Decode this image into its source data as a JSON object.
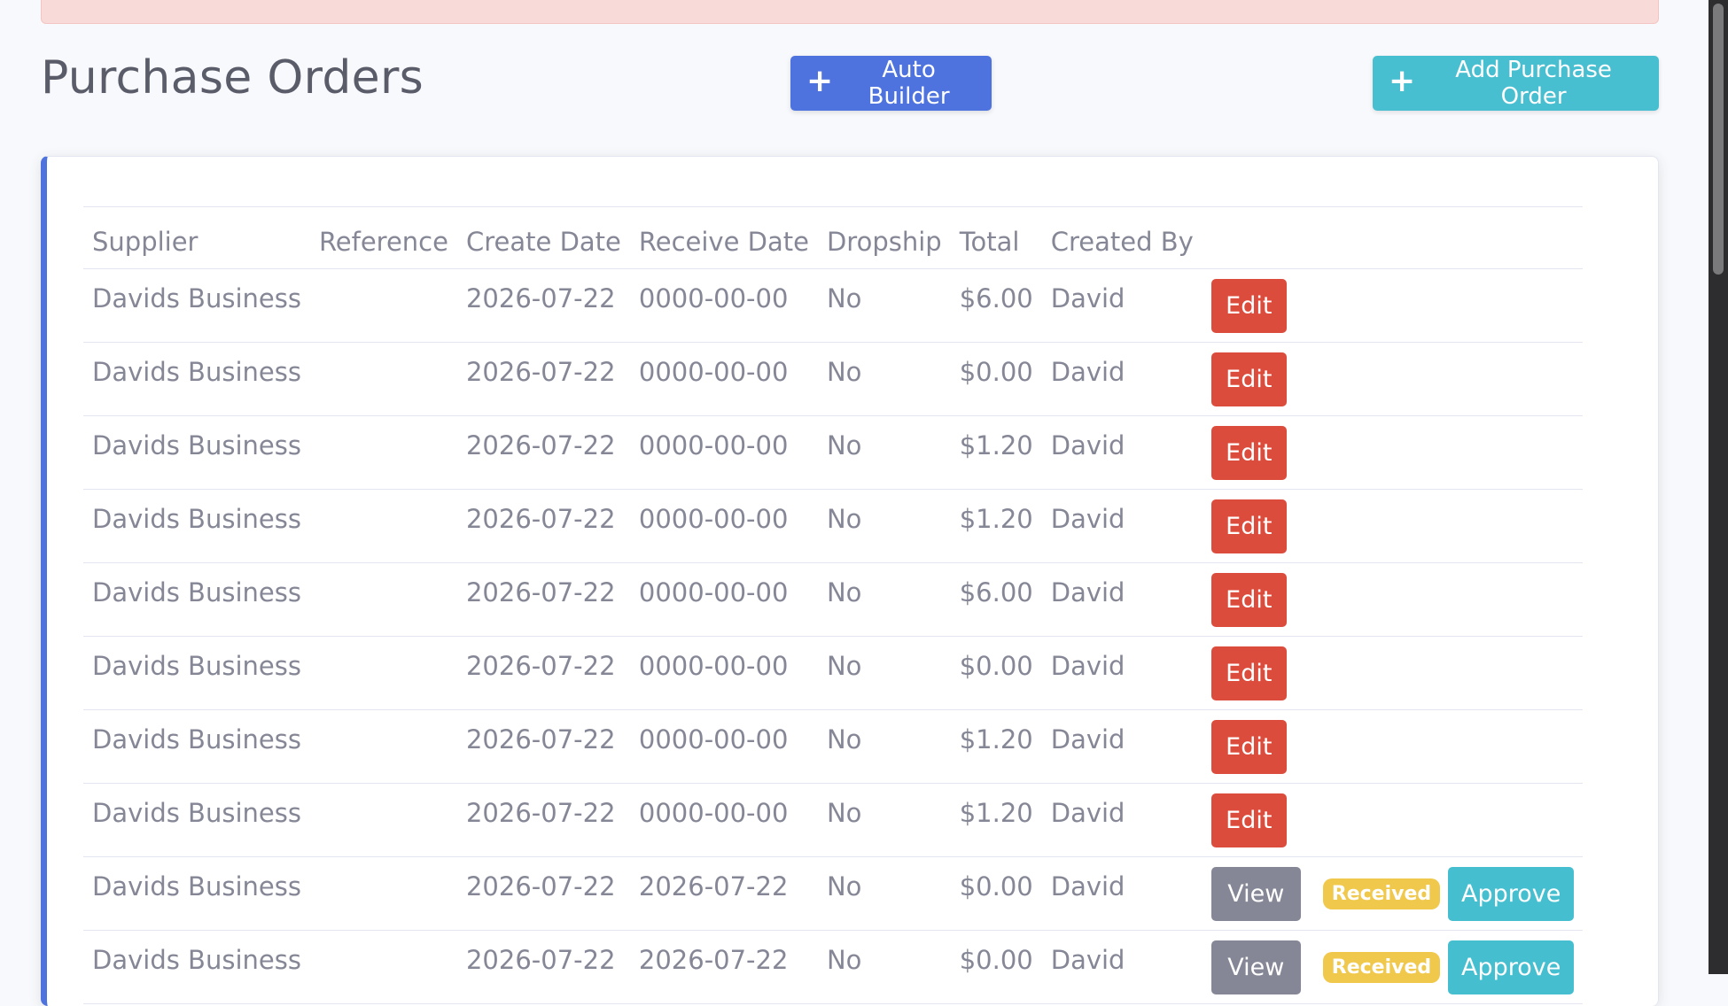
{
  "page": {
    "title": "Purchase Orders",
    "auto_builder_label": "Auto Builder",
    "add_po_label": "Add Purchase Order"
  },
  "colors": {
    "primary": "#4e73df",
    "info": "#36b9cc",
    "danger": "#dc4c3c",
    "secondary": "#858796",
    "warning": "#f0c84b",
    "alert_bg": "#f8dad8"
  },
  "icons": {
    "plus": "plus-icon"
  },
  "table": {
    "columns": [
      "Supplier",
      "Reference",
      "Create Date",
      "Receive Date",
      "Dropship",
      "Total",
      "Created By"
    ],
    "rows": [
      {
        "supplier": "Davids Business",
        "reference": "",
        "create_date": "2026-07-22",
        "receive_date": "0000-00-00",
        "dropship": "No",
        "total": "$6.00",
        "created_by": "David",
        "edit_label": "Edit"
      },
      {
        "supplier": "Davids Business",
        "reference": "",
        "create_date": "2026-07-22",
        "receive_date": "0000-00-00",
        "dropship": "No",
        "total": "$0.00",
        "created_by": "David",
        "edit_label": "Edit"
      },
      {
        "supplier": "Davids Business",
        "reference": "",
        "create_date": "2026-07-22",
        "receive_date": "0000-00-00",
        "dropship": "No",
        "total": "$1.20",
        "created_by": "David",
        "edit_label": "Edit"
      },
      {
        "supplier": "Davids Business",
        "reference": "",
        "create_date": "2026-07-22",
        "receive_date": "0000-00-00",
        "dropship": "No",
        "total": "$1.20",
        "created_by": "David",
        "edit_label": "Edit"
      },
      {
        "supplier": "Davids Business",
        "reference": "",
        "create_date": "2026-07-22",
        "receive_date": "0000-00-00",
        "dropship": "No",
        "total": "$6.00",
        "created_by": "David",
        "edit_label": "Edit"
      },
      {
        "supplier": "Davids Business",
        "reference": "",
        "create_date": "2026-07-22",
        "receive_date": "0000-00-00",
        "dropship": "No",
        "total": "$0.00",
        "created_by": "David",
        "edit_label": "Edit"
      },
      {
        "supplier": "Davids Business",
        "reference": "",
        "create_date": "2026-07-22",
        "receive_date": "0000-00-00",
        "dropship": "No",
        "total": "$1.20",
        "created_by": "David",
        "edit_label": "Edit"
      },
      {
        "supplier": "Davids Business",
        "reference": "",
        "create_date": "2026-07-22",
        "receive_date": "0000-00-00",
        "dropship": "No",
        "total": "$1.20",
        "created_by": "David",
        "edit_label": "Edit"
      },
      {
        "supplier": "Davids Business",
        "reference": "",
        "create_date": "2026-07-22",
        "receive_date": "2026-07-22",
        "dropship": "No",
        "total": "$0.00",
        "created_by": "David",
        "view_label": "View",
        "badge_label": "Received",
        "approve_label": "Approve"
      },
      {
        "supplier": "Davids Business",
        "reference": "",
        "create_date": "2026-07-22",
        "receive_date": "2026-07-22",
        "dropship": "No",
        "total": "$0.00",
        "created_by": "David",
        "view_label": "View",
        "badge_label": "Received",
        "approve_label": "Approve"
      }
    ]
  }
}
